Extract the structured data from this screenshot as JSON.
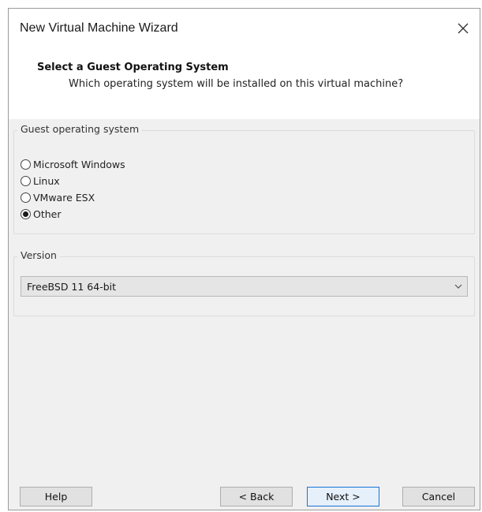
{
  "window": {
    "title": "New Virtual Machine Wizard"
  },
  "header": {
    "title": "Select a Guest Operating System",
    "subtitle": "Which operating system will be installed on this virtual machine?"
  },
  "guest_os": {
    "group_label": "Guest operating system",
    "options": [
      {
        "label": "Microsoft Windows",
        "selected": false
      },
      {
        "label": "Linux",
        "selected": false
      },
      {
        "label": "VMware ESX",
        "selected": false
      },
      {
        "label": "Other",
        "selected": true
      }
    ]
  },
  "version": {
    "group_label": "Version",
    "selected": "FreeBSD 11 64-bit"
  },
  "footer": {
    "help_label": "Help",
    "back_label": "< Back",
    "next_label": "Next >",
    "cancel_label": "Cancel"
  },
  "icons": {
    "close": "close-icon",
    "dropdown": "chevron-down-icon"
  },
  "colors": {
    "primary_button_border": "#1a73d8",
    "panel_background": "#f0f0f0"
  }
}
